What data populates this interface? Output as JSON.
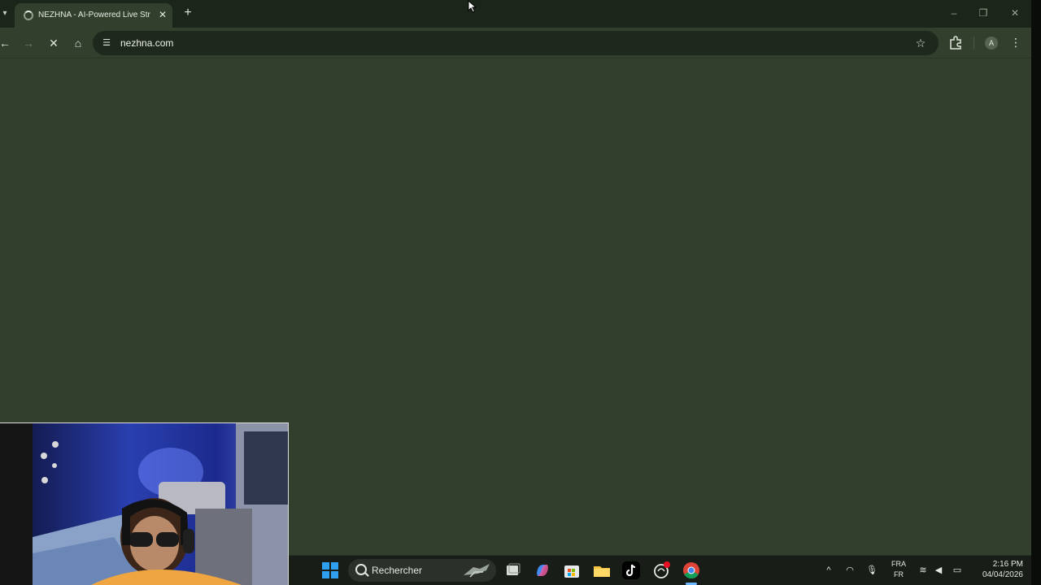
{
  "browser": {
    "tab": {
      "title": "NEZHNA - AI-Powered Live Str"
    },
    "omnibox": {
      "url": "nezhna.com"
    },
    "profile_initial": "A"
  },
  "taskbar": {
    "search_label": "Rechercher",
    "language": {
      "top": "FRA",
      "bottom": "FR"
    },
    "time": "2:16 PM",
    "date": "04/04/2026"
  },
  "colors": {
    "page_background": "#323f2d",
    "tab_strip": "#1c2519",
    "taskbar": "#181d17",
    "windows_blue": "#2f9ff0"
  },
  "icons": {
    "tab_strip": [
      "tab-search-icon",
      "loading-spinner-icon",
      "close-icon",
      "plus-icon",
      "minimize-icon",
      "restore-icon",
      "close-window-icon"
    ],
    "toolbar": [
      "back-arrow-icon",
      "forward-arrow-icon",
      "stop-loading-icon",
      "home-icon",
      "site-settings-icon",
      "bookmark-star-icon",
      "extensions-icon",
      "profile-avatar-icon",
      "more-menu-icon"
    ],
    "taskbar": [
      "windows-start-icon",
      "search-icon",
      "task-view-icon",
      "copilot-icon",
      "microsoft-store-icon",
      "file-explorer-icon",
      "tiktok-icon",
      "app-icon",
      "chrome-icon"
    ],
    "tray": [
      "chevron-up-icon",
      "headset-icon",
      "microphone-icon",
      "wifi-icon",
      "volume-icon",
      "battery-icon"
    ]
  }
}
